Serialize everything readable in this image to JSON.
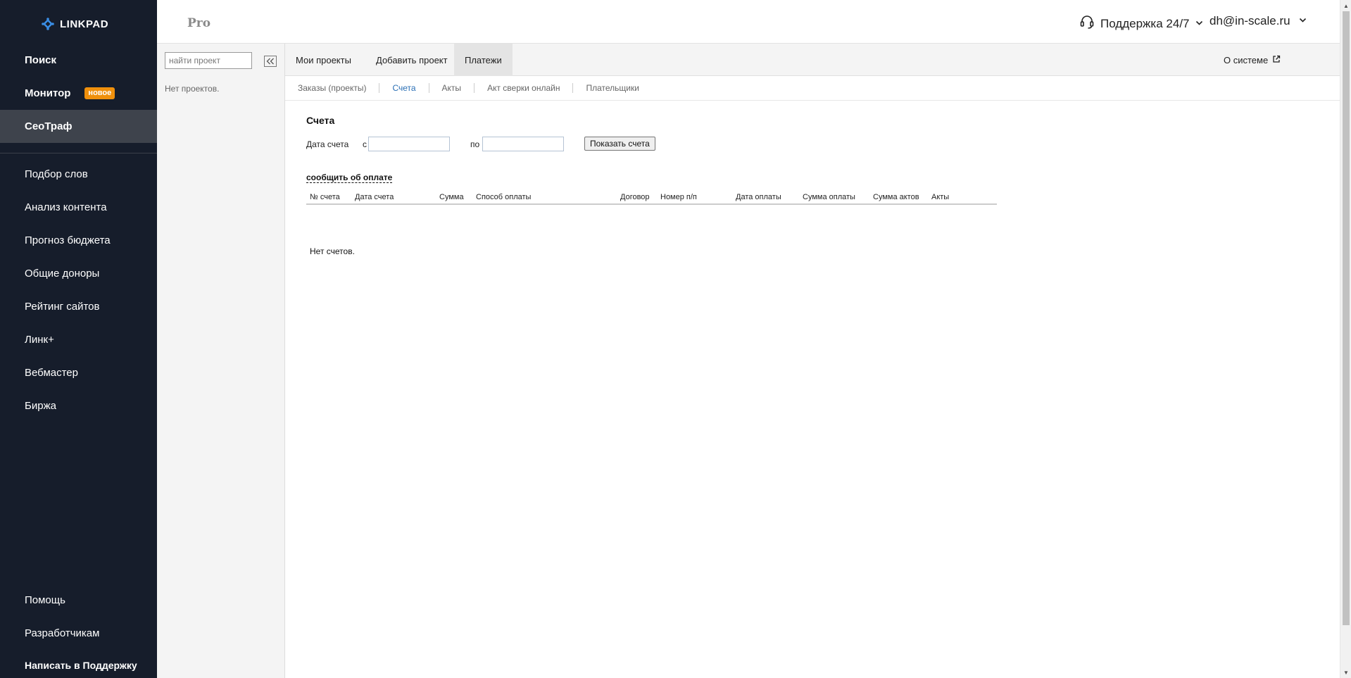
{
  "brand": {
    "name": "LINKPAD",
    "accent": "#3a8ee6",
    "sidebar_bg": "#161d2b",
    "badge_color": "#f0900c",
    "link_color": "#2a6fb5"
  },
  "sidebar": {
    "items": [
      {
        "label": "Поиск"
      },
      {
        "label": "Монитор",
        "badge": "новое"
      },
      {
        "label": "СеоТраф"
      },
      {
        "label": "Подбор слов"
      },
      {
        "label": "Анализ контента"
      },
      {
        "label": "Прогноз бюджета"
      },
      {
        "label": "Общие доноры"
      },
      {
        "label": "Рейтинг сайтов"
      },
      {
        "label": "Линк+"
      },
      {
        "label": "Вебмастер"
      },
      {
        "label": "Биржа"
      }
    ],
    "bottom": [
      {
        "label": "Помощь"
      },
      {
        "label": "Разработчикам"
      },
      {
        "label": "Написать в Поддержку"
      }
    ]
  },
  "header": {
    "plan": "Pro",
    "support": "Поддержка 24/7",
    "user_email": "dh@in-scale.ru"
  },
  "projects": {
    "search_placeholder": "найти проект",
    "empty": "Нет проектов."
  },
  "main_tabs": [
    {
      "label": "Мои проекты"
    },
    {
      "label": "Добавить проект"
    },
    {
      "label": "Платежи"
    }
  ],
  "about": "О системе",
  "sub_tabs": [
    {
      "label": "Заказы (проекты)"
    },
    {
      "label": "Счета"
    },
    {
      "label": "Акты"
    },
    {
      "label": "Акт сверки онлайн"
    },
    {
      "label": "Плательщики"
    }
  ],
  "invoices": {
    "title": "Счета",
    "date_label": "Дата счета",
    "from_label": "с",
    "to_label": "по",
    "show_button": "Показать счета",
    "report_payment": "сообщить об оплате",
    "columns": [
      "№ счета",
      "Дата счета",
      "Сумма",
      "Способ оплаты",
      "Договор",
      "Номер п/п",
      "Дата оплаты",
      "Сумма оплаты",
      "Сумма актов",
      "Акты"
    ],
    "empty": "Нет счетов."
  },
  "icons": {
    "logo": "linkpad-logo-icon",
    "headset": "headset-icon",
    "chevron": "chevron-down-icon",
    "collapse": "double-chevron-left-icon",
    "external": "external-link-icon"
  }
}
